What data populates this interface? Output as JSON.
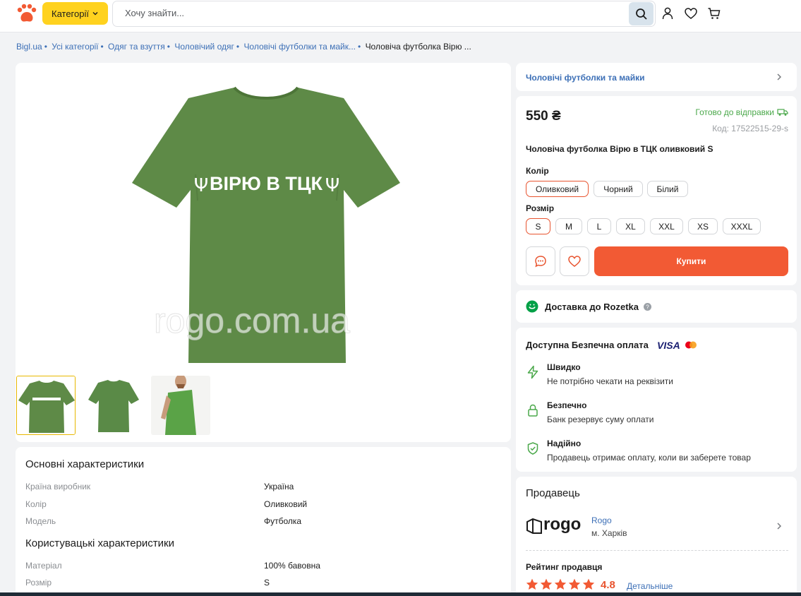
{
  "header": {
    "category_label": "Категорії",
    "search_placeholder": "Хочу знайти..."
  },
  "breadcrumb": [
    "Bigl.ua",
    "Усі категорії",
    "Одяг та взуття",
    "Чоловічий одяг",
    "Чоловічі футболки та майк...",
    "Чоловіча футболка Вірю ..."
  ],
  "gallery": {
    "shirt_text": "ВІРЮ В ТЦК",
    "watermark": "rogo.com.ua",
    "shirt_color": "#5e8a47"
  },
  "specs": {
    "main_title": "Основні характеристики",
    "main_rows": [
      {
        "k": "Країна виробник",
        "v": "Україна"
      },
      {
        "k": "Колір",
        "v": "Оливковий"
      },
      {
        "k": "Модель",
        "v": "Футболка"
      }
    ],
    "user_title": "Користувацькі характеристики",
    "user_rows": [
      {
        "k": "Матеріал",
        "v": "100% бавовна"
      },
      {
        "k": "Розмір",
        "v": "S"
      }
    ]
  },
  "category_link": "Чоловічі футболки та майки",
  "product": {
    "price": "550 ₴",
    "status": "Готово до відправки",
    "code": "Код: 17522515-29-s",
    "title": "Чоловіча футболка Вірю в ТЦК оливковий S",
    "color_label": "Колір",
    "colors": [
      "Оливковий",
      "Чорний",
      "Білий"
    ],
    "size_label": "Розмір",
    "sizes": [
      "S",
      "M",
      "L",
      "XL",
      "XXL",
      "XS",
      "XXXL"
    ],
    "buy_label": "Купити"
  },
  "delivery": "Доставка до Rozetka",
  "payment": {
    "title": "Доступна Безпечна оплата",
    "visa": "VISA",
    "items": [
      {
        "t": "Швидко",
        "d": "Не потрібно чекати на реквізити"
      },
      {
        "t": "Безпечно",
        "d": "Банк резервує суму оплати"
      },
      {
        "t": "Надійно",
        "d": "Продавець отримає оплату, коли ви заберете товар"
      }
    ]
  },
  "seller": {
    "title": "Продавець",
    "logo_text": "rogo",
    "name": "Rogo",
    "city": "м. Харків",
    "rating_title": "Рейтинг продавця",
    "rating": 4.8,
    "rating_text": "4.8",
    "more": "Детальніше"
  },
  "colors": {
    "accent": "#f25a34",
    "yellow": "#ffd21f",
    "link": "#3c6fb6",
    "green": "#4aa84a"
  }
}
